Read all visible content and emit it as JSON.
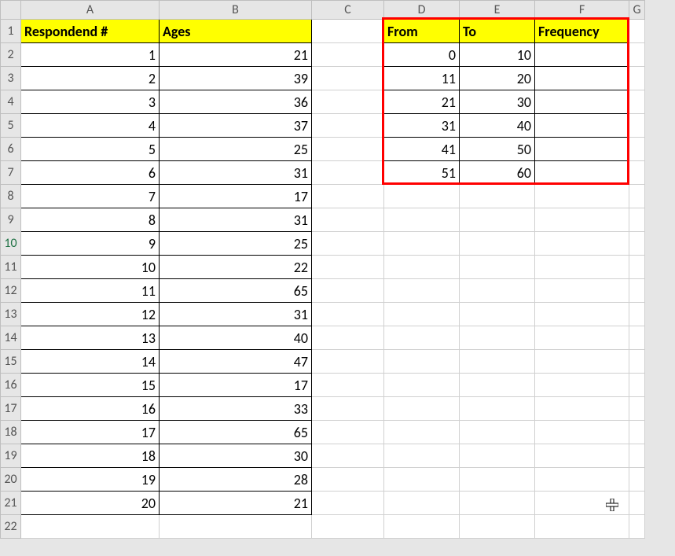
{
  "columns": {
    "A": "A",
    "B": "B",
    "C": "C",
    "D": "D",
    "E": "E",
    "F": "F",
    "G": "G"
  },
  "rows": [
    "1",
    "2",
    "3",
    "4",
    "5",
    "6",
    "7",
    "8",
    "9",
    "10",
    "11",
    "12",
    "13",
    "14",
    "15",
    "16",
    "17",
    "18",
    "19",
    "20",
    "21",
    "22"
  ],
  "main_headers": {
    "A": "Respondend #",
    "B": "Ages"
  },
  "respondents": [
    {
      "n": "1",
      "age": "21"
    },
    {
      "n": "2",
      "age": "39"
    },
    {
      "n": "3",
      "age": "36"
    },
    {
      "n": "4",
      "age": "37"
    },
    {
      "n": "5",
      "age": "25"
    },
    {
      "n": "6",
      "age": "31"
    },
    {
      "n": "7",
      "age": "17"
    },
    {
      "n": "8",
      "age": "31"
    },
    {
      "n": "9",
      "age": "25"
    },
    {
      "n": "10",
      "age": "22"
    },
    {
      "n": "11",
      "age": "65"
    },
    {
      "n": "12",
      "age": "31"
    },
    {
      "n": "13",
      "age": "40"
    },
    {
      "n": "14",
      "age": "47"
    },
    {
      "n": "15",
      "age": "17"
    },
    {
      "n": "16",
      "age": "33"
    },
    {
      "n": "17",
      "age": "65"
    },
    {
      "n": "18",
      "age": "30"
    },
    {
      "n": "19",
      "age": "28"
    },
    {
      "n": "20",
      "age": "21"
    }
  ],
  "freq_headers": {
    "D": "From",
    "E": "To",
    "F": "Frequency"
  },
  "freq_table": [
    {
      "from": "0",
      "to": "10",
      "freq": ""
    },
    {
      "from": "11",
      "to": "20",
      "freq": ""
    },
    {
      "from": "21",
      "to": "30",
      "freq": ""
    },
    {
      "from": "31",
      "to": "40",
      "freq": ""
    },
    {
      "from": "41",
      "to": "50",
      "freq": ""
    },
    {
      "from": "51",
      "to": "60",
      "freq": ""
    }
  ],
  "active_row": "10"
}
